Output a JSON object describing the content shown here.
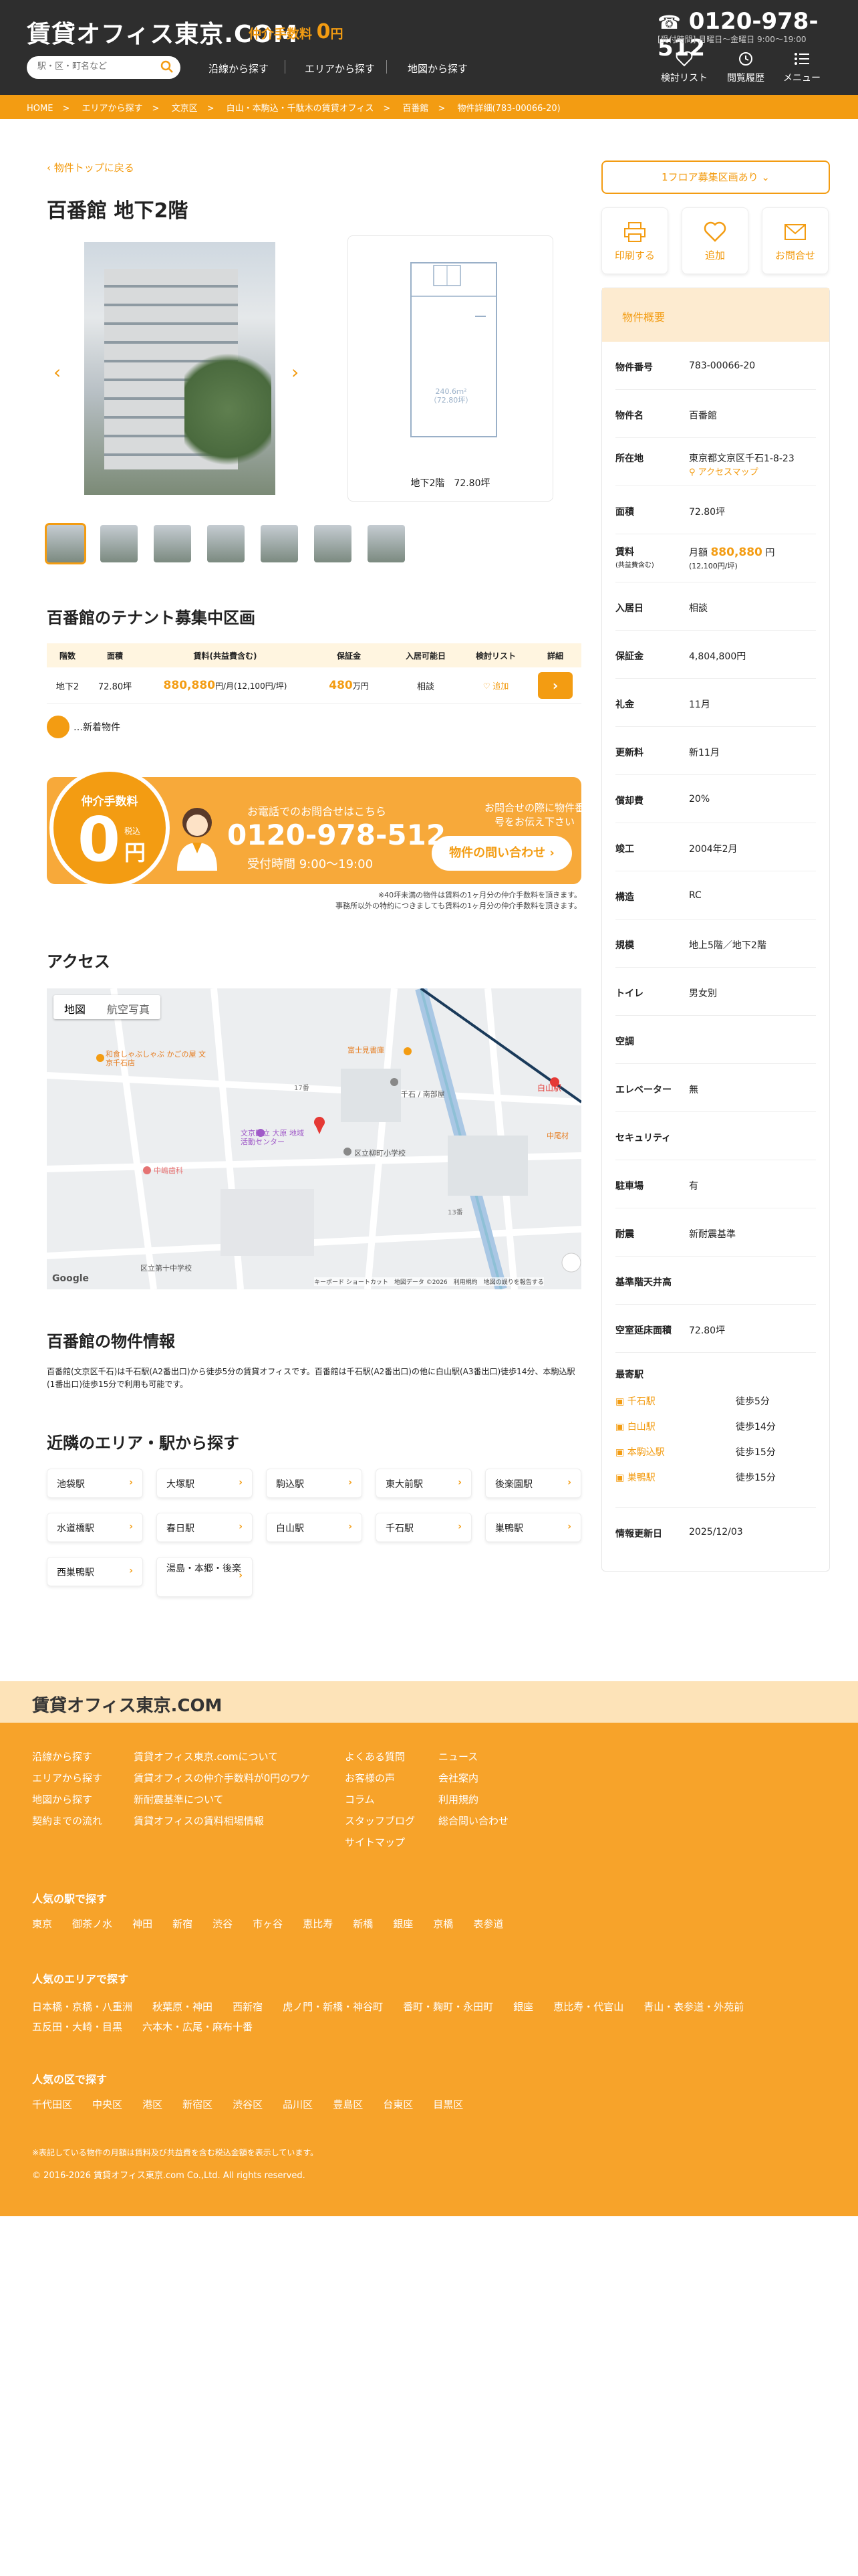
{
  "header": {
    "logo": "賃貸オフィス東京.COM",
    "fee_label": "仲介手数料",
    "fee_value": "0",
    "fee_unit": "円",
    "search_placeholder": "駅・区・町名など",
    "nav": [
      "沿線から探す",
      "エリアから探す",
      "地図から探す"
    ],
    "tel": "0120-978-512",
    "tel_sub": "[受付時間] 月曜日～金曜日 9:00～19:00",
    "icons": [
      "検討リスト",
      "閲覧履歴",
      "メニュー"
    ]
  },
  "breadcrumb": [
    "HOME",
    "エリアから探す",
    "文京区",
    "白山・本駒込・千駄木の賃貸オフィス",
    "百番館",
    "物件詳細(783-00066-20)"
  ],
  "back": "物件トップに戻る",
  "title": "百番館 地下2階",
  "plan": {
    "area_text": "240.6ｍ²",
    "area_text2": "（72.80坪）",
    "caption": "地下2階　72.80坪"
  },
  "section_zone": "百番館のテナント募集中区画",
  "table": {
    "headers": [
      "階数",
      "面積",
      "賃料(共益費含む)",
      "保証金",
      "入居可能日",
      "検討リスト",
      "詳細"
    ],
    "row": {
      "floor": "地下2",
      "area": "72.80坪",
      "price": "880,880",
      "price_suffix": "円/月(12,100円/坪)",
      "deposit": "480",
      "deposit_unit": "万円",
      "date": "相談",
      "fav": "♡ 追加"
    }
  },
  "new_label": "…新着物件",
  "cta": {
    "circle_top": "仲介手数料",
    "zero": "0",
    "yen": "円",
    "tax": "税込",
    "phone_lead": "お電話でのお問合せはこちら",
    "phone": "0120-978-512",
    "hours": "受付時間 9:00～19:00",
    "right_lead": "お問合せの際に物件番号をお伝え下さい",
    "button": "物件の問い合わせ",
    "note1": "※40坪未満の物件は賃料の1ヶ月分の仲介手数料を頂きます。",
    "note2": "事務所以外の特約につきましても賃料の1ヶ月分の仲介手数料を頂きます。"
  },
  "access": {
    "title": "アクセス",
    "tabs": [
      "地図",
      "航空写真"
    ],
    "labels": [
      "和食しゃぶしゃぶ かごの屋 文京千石店",
      "富士見書庫",
      "千石 / 南部屋",
      "文京区立 大原 地域活動センター",
      "区立柳町小学校",
      "中嶋歯科",
      "区立第十中学校",
      "白山駅",
      "中尾材",
      "17番",
      "13番",
      "キーボード ショートカット",
      "地図データ ©2026",
      "利用規約",
      "地図の誤りを報告する",
      "Google"
    ]
  },
  "info": {
    "title": "百番館の物件情報",
    "text": "百番館(文京区千石)は千石駅(A2番出口)から徒歩5分の賃貸オフィスです。百番館は千石駅(A2番出口)の他に白山駅(A3番出口)徒歩14分、本駒込駅(1番出口)徒歩15分で利用も可能です。"
  },
  "nearby": {
    "title": "近隣のエリア・駅から探す",
    "items": [
      "池袋駅",
      "大塚駅",
      "駒込駅",
      "東大前駅",
      "後楽園駅",
      "水道橋駅",
      "春日駅",
      "白山駅",
      "千石駅",
      "巣鴨駅",
      "西巣鴨駅",
      "湯島・本郷・後楽"
    ]
  },
  "side": {
    "floor_btn": "1フロア募集区画あり",
    "actions": [
      "印刷する",
      "追加",
      "お問合せ"
    ],
    "summary_title": "物件概要",
    "rows": [
      {
        "k": "物件番号",
        "v": "783-00066-20"
      },
      {
        "k": "物件名",
        "v": "百番館"
      },
      {
        "k": "所在地",
        "v": "東京都文京区千石1-8-23",
        "link": "アクセスマップ"
      },
      {
        "k": "面積",
        "v": "72.80坪"
      },
      {
        "k": "賃料",
        "ksub": "(共益費含む)",
        "v_pre": "月額",
        "v": "880,880",
        "v_post": "円",
        "v_sub": "(12,100円/坪)"
      },
      {
        "k": "入居日",
        "v": "相談"
      },
      {
        "k": "保証金",
        "v": "4,804,800円"
      },
      {
        "k": "礼金",
        "v": "11月"
      },
      {
        "k": "更新料",
        "v": "新11月"
      },
      {
        "k": "償却費",
        "v": "20%"
      },
      {
        "k": "竣工",
        "v": "2004年2月"
      },
      {
        "k": "構造",
        "v": "RC"
      },
      {
        "k": "規模",
        "v": "地上5階／地下2階"
      },
      {
        "k": "トイレ",
        "v": "男女別"
      },
      {
        "k": "空調",
        "v": ""
      },
      {
        "k": "エレベーター",
        "v": "無"
      },
      {
        "k": "セキュリティ",
        "v": ""
      },
      {
        "k": "駐車場",
        "v": "有"
      },
      {
        "k": "耐震",
        "v": "新耐震基準"
      },
      {
        "k": "基準階天井高",
        "v": ""
      },
      {
        "k": "空室延床面積",
        "v": "72.80坪"
      }
    ],
    "station_label": "最寄駅",
    "stations": [
      {
        "n": "千石駅",
        "w": "徒歩5分"
      },
      {
        "n": "白山駅",
        "w": "徒歩14分"
      },
      {
        "n": "本駒込駅",
        "w": "徒歩15分"
      },
      {
        "n": "巣鴨駅",
        "w": "徒歩15分"
      }
    ],
    "updated_k": "情報更新日",
    "updated_v": "2025/12/03"
  },
  "footer": {
    "logo": "賃貸オフィス東京.COM",
    "col1": [
      "沿線から探す",
      "エリアから探す",
      "地図から探す",
      "契約までの流れ"
    ],
    "col2": [
      "賃貸オフィス東京.comについて",
      "賃貸オフィスの仲介手数料が0円のワケ",
      "新耐震基準について",
      "賃貸オフィスの賃料相場情報"
    ],
    "col3": [
      "よくある質問",
      "お客様の声",
      "コラム",
      "スタッフブログ",
      "サイトマップ"
    ],
    "col4": [
      "ニュース",
      "会社案内",
      "利用規約",
      "総合問い合わせ"
    ],
    "stations_title": "人気の駅で探す",
    "stations": [
      "東京",
      "御茶ノ水",
      "神田",
      "新宿",
      "渋谷",
      "市ヶ谷",
      "恵比寿",
      "新橋",
      "銀座",
      "京橋",
      "表参道"
    ],
    "areas_title": "人気のエリアで探す",
    "areas": [
      "日本橋・京橋・八重洲",
      "秋葉原・神田",
      "西新宿",
      "虎ノ門・新橋・神谷町",
      "番町・麹町・永田町",
      "銀座",
      "恵比寿・代官山",
      "青山・表参道・外苑前",
      "五反田・大崎・目黒",
      "六本木・広尾・麻布十番"
    ],
    "wards_title": "人気の区で探す",
    "wards": [
      "千代田区",
      "中央区",
      "港区",
      "新宿区",
      "渋谷区",
      "品川区",
      "豊島区",
      "台東区",
      "目黒区"
    ],
    "note": "※表記している物件の月額は賃料及び共益費を含む税込金額を表示しています。",
    "copy": "© 2016-2026 賃貸オフィス東京.com Co.,Ltd. All rights reserved."
  },
  "colors": {
    "accent": "#f39c12",
    "header": "#2e2e2e"
  }
}
